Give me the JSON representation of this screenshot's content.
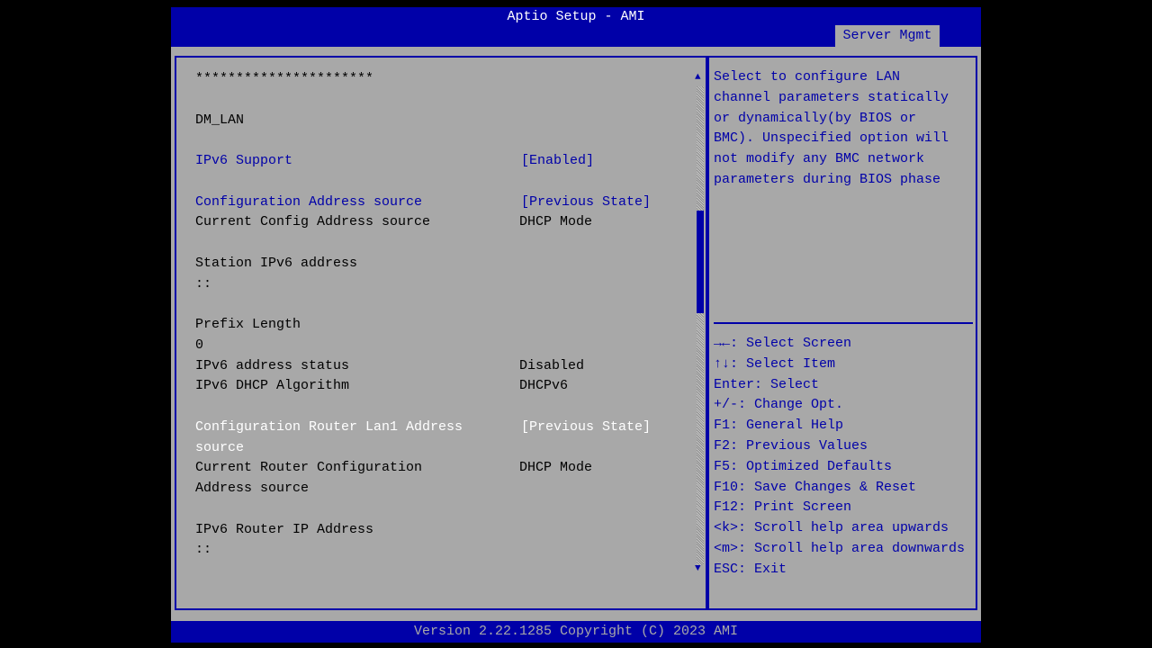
{
  "header": {
    "title": "Aptio Setup - AMI",
    "active_tab": "Server Mgmt"
  },
  "rows": [
    {
      "line": 0,
      "label": "**********************",
      "value": "",
      "style": "black"
    },
    {
      "line": 2,
      "label": "DM_LAN",
      "value": "",
      "style": "black"
    },
    {
      "line": 4,
      "label": "IPv6 Support",
      "value": "[Enabled]",
      "style": "blue"
    },
    {
      "line": 6,
      "label": "Configuration Address source",
      "value": "[Previous State]",
      "style": "blue"
    },
    {
      "line": 7,
      "label": "Current Config Address source",
      "value": "DHCP Mode",
      "style": "black"
    },
    {
      "line": 9,
      "label": "Station IPv6 address",
      "value": "",
      "style": "black"
    },
    {
      "line": 10,
      "label": "::",
      "value": "",
      "style": "black"
    },
    {
      "line": 12,
      "label": "Prefix Length",
      "value": "",
      "style": "black"
    },
    {
      "line": 13,
      "label": "0",
      "value": "",
      "style": "black"
    },
    {
      "line": 14,
      "label": "IPv6 address status",
      "value": "Disabled",
      "style": "black"
    },
    {
      "line": 15,
      "label": "IPv6 DHCP Algorithm",
      "value": "DHCPv6",
      "style": "black"
    },
    {
      "line": 17,
      "label": "Configuration Router Lan1 Address",
      "value": "[Previous State]",
      "style": "white"
    },
    {
      "line": 18,
      "label": "source",
      "value": "",
      "style": "white"
    },
    {
      "line": 19,
      "label": "Current Router Configuration",
      "value": "DHCP Mode",
      "style": "black"
    },
    {
      "line": 20,
      "label": "Address source",
      "value": "",
      "style": "black"
    },
    {
      "line": 22,
      "label": "IPv6 Router IP Address",
      "value": "",
      "style": "black"
    },
    {
      "line": 23,
      "label": "::",
      "value": "",
      "style": "black"
    }
  ],
  "help_text": "Select to configure LAN\nchannel parameters statically\nor dynamically(by BIOS or\nBMC). Unspecified option will\nnot modify any BMC network\nparameters during BIOS phase",
  "keys": [
    "→←: Select Screen",
    "↑↓: Select Item",
    "Enter: Select",
    "+/-: Change Opt.",
    "F1: General Help",
    "F2: Previous Values",
    "F5: Optimized Defaults",
    "F10: Save Changes & Reset",
    "F12: Print Screen",
    "<k>: Scroll help area upwards",
    "<m>: Scroll help area downwards",
    "ESC: Exit"
  ],
  "footer": "Version 2.22.1285 Copyright (C) 2023 AMI",
  "scroll_position_percent": 30,
  "colors": {
    "blue": "#0000a8",
    "gray": "#a8a8a8",
    "selected": "#ffffff"
  }
}
